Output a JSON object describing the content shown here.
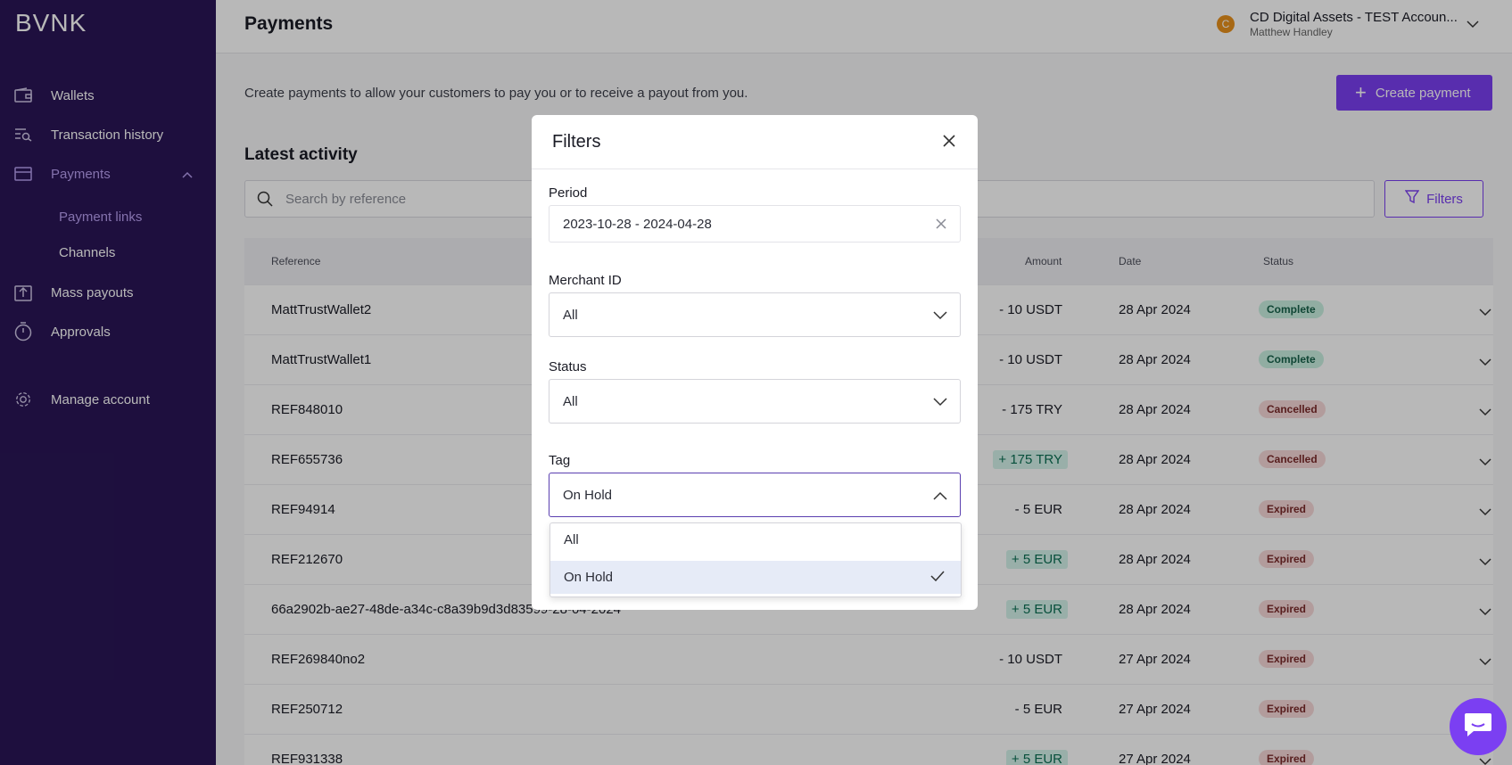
{
  "brand": {
    "logo": "BVNK",
    "accent": "#7b3ff2",
    "sidebar_bg": "#2a1656"
  },
  "sidebar": {
    "items": [
      {
        "label": "Wallets",
        "icon": "wallet-icon"
      },
      {
        "label": "Transaction history",
        "icon": "search-list-icon"
      },
      {
        "label": "Payments",
        "icon": "card-icon",
        "expanded": true
      },
      {
        "label": "Mass payouts",
        "icon": "upload-icon"
      },
      {
        "label": "Approvals",
        "icon": "stopwatch-icon"
      },
      {
        "label": "Manage account",
        "icon": "gear-icon"
      }
    ],
    "sub_items": [
      {
        "label": "Payment links",
        "active": true
      },
      {
        "label": "Channels"
      }
    ]
  },
  "header": {
    "title": "Payments",
    "account_initial": "C",
    "account_name": "CD Digital Assets - TEST Accoun...",
    "account_user": "Matthew Handley"
  },
  "main": {
    "intro": "Create payments to allow your customers to pay you or to receive a payout from you.",
    "create_label": "Create payment",
    "section_title": "Latest activity",
    "search_placeholder": "Search by reference",
    "filters_label": "Filters"
  },
  "table": {
    "columns": [
      "Reference",
      "Amount",
      "Date",
      "Status"
    ],
    "rows": [
      {
        "ref": "MattTrustWallet2",
        "amount": "- 10 USDT",
        "positive": false,
        "date": "28 Apr 2024",
        "status": "Complete"
      },
      {
        "ref": "MattTrustWallet1",
        "amount": "- 10 USDT",
        "positive": false,
        "date": "28 Apr 2024",
        "status": "Complete"
      },
      {
        "ref": "REF848010",
        "amount": "- 175 TRY",
        "positive": false,
        "date": "28 Apr 2024",
        "status": "Cancelled"
      },
      {
        "ref": "REF655736",
        "amount": "+ 175 TRY",
        "positive": true,
        "date": "28 Apr 2024",
        "status": "Cancelled"
      },
      {
        "ref": "REF94914",
        "amount": "- 5 EUR",
        "positive": false,
        "date": "28 Apr 2024",
        "status": "Expired"
      },
      {
        "ref": "REF212670",
        "amount": "+ 5 EUR",
        "positive": true,
        "date": "28 Apr 2024",
        "status": "Expired"
      },
      {
        "ref": "66a2902b-ae27-48de-a34c-c8a39b9d3d83599-28-04-2024",
        "amount": "+ 5 EUR",
        "positive": true,
        "date": "28 Apr 2024",
        "status": "Expired"
      },
      {
        "ref": "REF269840no2",
        "amount": "- 10 USDT",
        "positive": false,
        "date": "27 Apr 2024",
        "status": "Expired"
      },
      {
        "ref": "REF250712",
        "amount": "- 5 EUR",
        "positive": false,
        "date": "27 Apr 2024",
        "status": "Expired"
      },
      {
        "ref": "REF931338",
        "amount": "+ 5 EUR",
        "positive": true,
        "date": "27 Apr 2024",
        "status": "Expired"
      }
    ]
  },
  "modal": {
    "title": "Filters",
    "period_label": "Period",
    "period_value": "2023-10-28 - 2024-04-28",
    "merchant_label": "Merchant ID",
    "merchant_value": "All",
    "status_label": "Status",
    "status_value": "All",
    "tag_label": "Tag",
    "tag_value": "On Hold",
    "tag_options": [
      {
        "label": "All",
        "selected": false
      },
      {
        "label": "On Hold",
        "selected": true
      }
    ]
  }
}
